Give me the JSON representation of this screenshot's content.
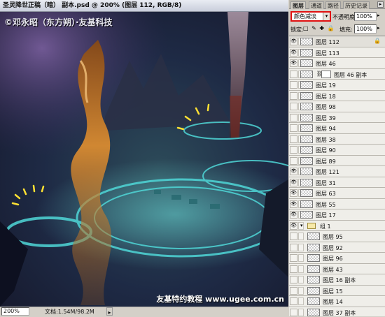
{
  "document": {
    "title": "圣灵降世正稿（暗） 副本.psd @ 200% (图层 112, RGB/8)",
    "watermark_top": "©邓永昭（东方朔）·友基科技",
    "watermark_bottom": "友基特约教程 www.ugee.com.cn",
    "status": {
      "zoom": "200%",
      "doc_info": "文档:1.54M/98.2M",
      "arrow": "▸"
    }
  },
  "panel": {
    "tabs": [
      "图层",
      "通道",
      "路径",
      "历史记录"
    ],
    "menu_glyph": "▸",
    "blend_mode": "颜色减淡",
    "blend_dropdown_glyph": "▾",
    "opacity_label": "不透明度:",
    "opacity_value": "100%",
    "lock_label": "锁定:",
    "lock_icons": "□ ✎ ✚ 🔒",
    "fill_label": "填充:",
    "fill_value": "100%",
    "spin_glyph": "▸",
    "eye_glyph": "👁",
    "lock_glyph": "🔒",
    "folder_arrow_glyph": "▾",
    "chain_glyph": "⛓",
    "layers": [
      {
        "name": "图层 112",
        "visible": true,
        "selected": true,
        "locked": true,
        "kind": "layer"
      },
      {
        "name": "图层 113",
        "visible": true,
        "kind": "layer"
      },
      {
        "name": "图层 46",
        "visible": true,
        "kind": "layer"
      },
      {
        "name": "图层 46 副本",
        "visible": false,
        "kind": "masked"
      },
      {
        "name": "图层 19",
        "visible": false,
        "kind": "layer"
      },
      {
        "name": "图层 18",
        "visible": false,
        "kind": "layer"
      },
      {
        "name": "图层 98",
        "visible": false,
        "kind": "layer"
      },
      {
        "name": "图层 39",
        "visible": false,
        "kind": "layer"
      },
      {
        "name": "图层 94",
        "visible": false,
        "kind": "layer"
      },
      {
        "name": "图层 38",
        "visible": false,
        "kind": "layer"
      },
      {
        "name": "图层 90",
        "visible": false,
        "kind": "layer"
      },
      {
        "name": "图层 89",
        "visible": false,
        "kind": "layer"
      },
      {
        "name": "图层 121",
        "visible": true,
        "kind": "layer"
      },
      {
        "name": "图层 31",
        "visible": true,
        "kind": "layer"
      },
      {
        "name": "图层 63",
        "visible": true,
        "kind": "layer"
      },
      {
        "name": "图层 55",
        "visible": true,
        "kind": "layer"
      },
      {
        "name": "图层 17",
        "visible": true,
        "kind": "layer"
      },
      {
        "name": "组 1",
        "visible": true,
        "kind": "group"
      },
      {
        "name": "图层 95",
        "visible": false,
        "kind": "child"
      },
      {
        "name": "图层 92",
        "visible": false,
        "kind": "child"
      },
      {
        "name": "图层 96",
        "visible": false,
        "kind": "child"
      },
      {
        "name": "图层 43",
        "visible": false,
        "kind": "child"
      },
      {
        "name": "图层 16 副本",
        "visible": false,
        "kind": "child"
      },
      {
        "name": "图层 15",
        "visible": false,
        "kind": "child"
      },
      {
        "name": "图层 14",
        "visible": false,
        "kind": "child"
      },
      {
        "name": "图层 37 副本",
        "visible": false,
        "kind": "child"
      }
    ]
  },
  "colors": {
    "highlight_border": "#e01010",
    "flame": "#d9822b",
    "magic_circle": "#4fd7d7",
    "sparks": "#ffe033"
  }
}
